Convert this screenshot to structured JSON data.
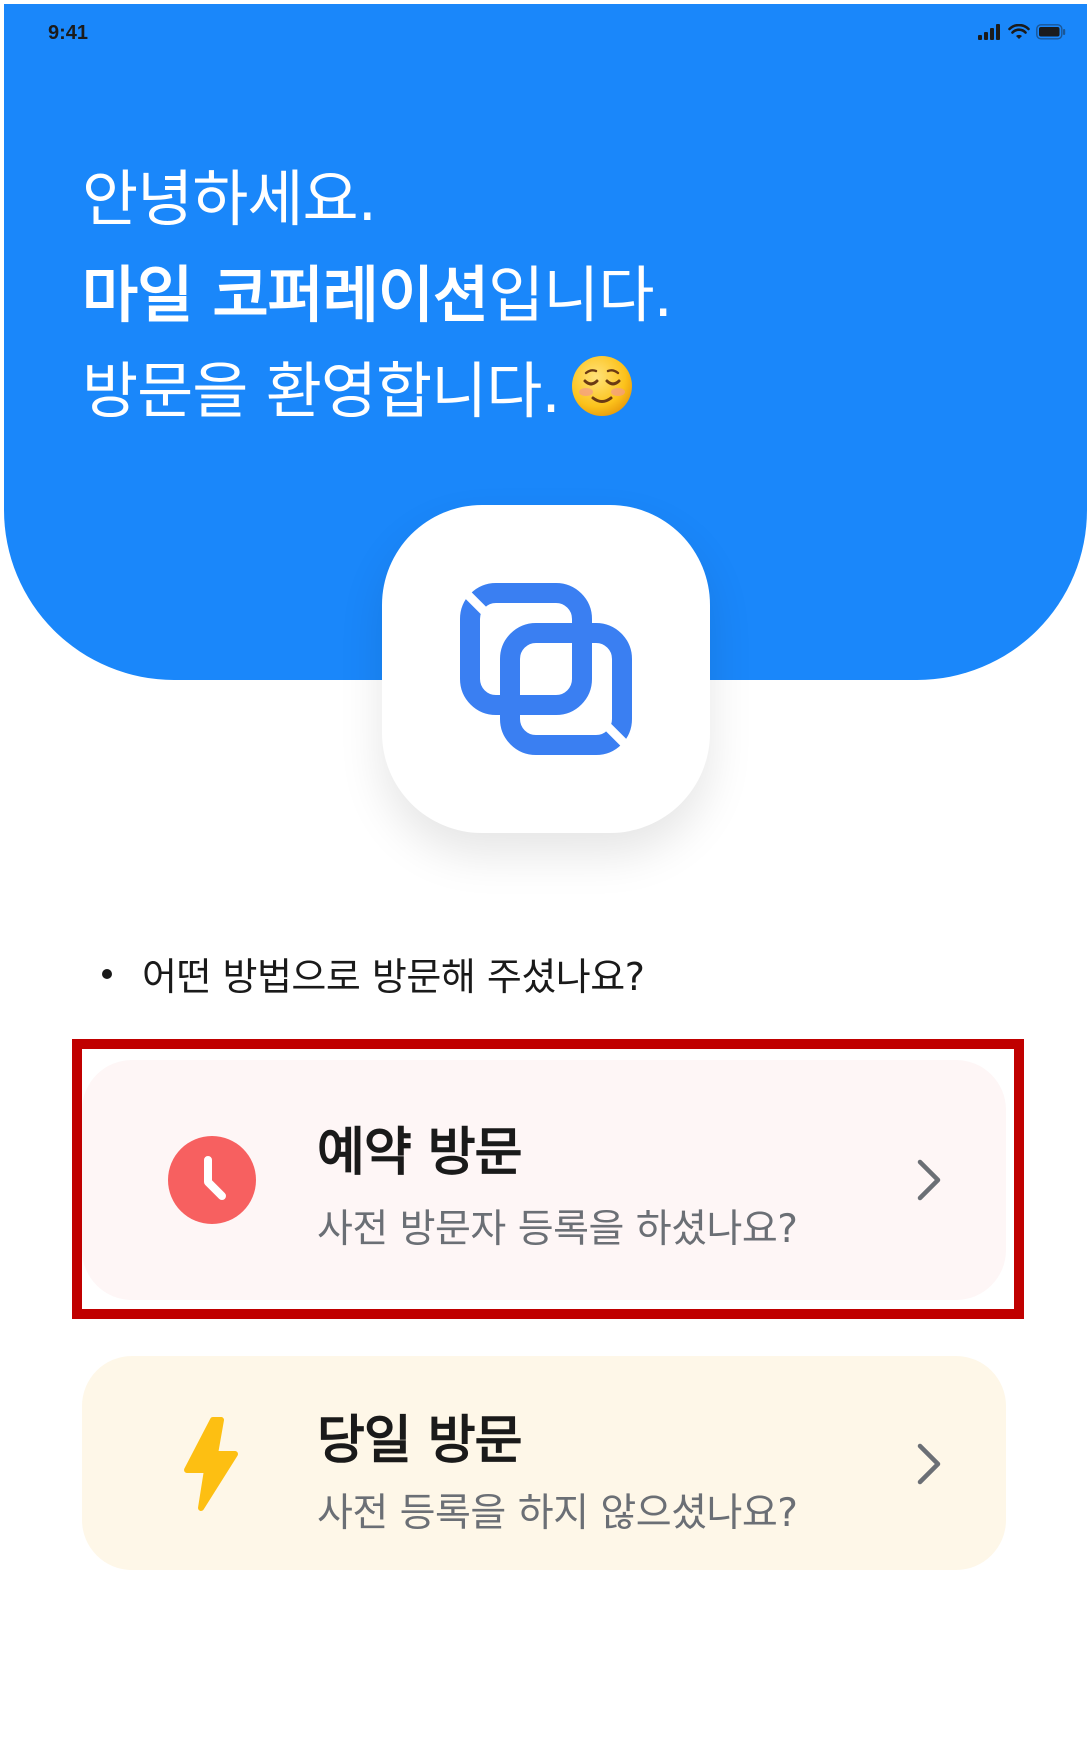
{
  "status_bar": {
    "time": "9:41"
  },
  "greeting": {
    "line1": "안녕하세요.",
    "line2_bold": "마일 코퍼레이션",
    "line2_rest": "입니다.",
    "line3": "방문을 환영합니다."
  },
  "question": {
    "text": "어떤 방법으로 방문해 주셨나요?"
  },
  "options": [
    {
      "title": "예약 방문",
      "subtitle": "사전 방문자 등록을 하셨나요?",
      "icon": "clock-icon",
      "color": "#F76060"
    },
    {
      "title": "당일 방문",
      "subtitle": "사전 등록을 하지 않으셨나요?",
      "icon": "lightning-icon",
      "color": "#FDBF12"
    }
  ],
  "colors": {
    "hero": "#1A87FA",
    "logo": "#3A7FF2",
    "highlight": "#C00000"
  }
}
